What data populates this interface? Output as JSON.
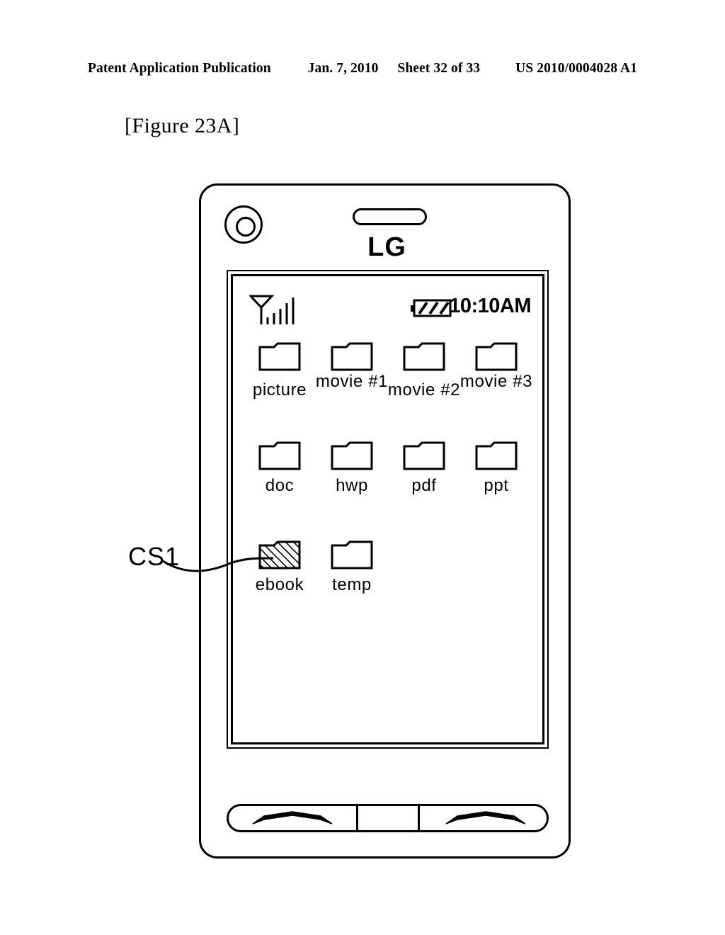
{
  "page_header": {
    "publication": "Patent Application Publication",
    "date": "Jan. 7, 2010",
    "sheet": "Sheet 32 of 33",
    "patent_number": "US 2010/0004028 A1"
  },
  "figure": {
    "label": "[Figure 23A]"
  },
  "device": {
    "brand": "LG",
    "camera_icon": "camera-lens-icon",
    "speaker_icon": "earpiece-speaker-icon",
    "status_bar": {
      "signal_icon": "antenna-signal-icon",
      "signal_bars": 5,
      "battery_icon": "battery-icon",
      "battery_segments": 3,
      "time": "10:10AM"
    },
    "folders": {
      "row_1": [
        {
          "label": "picture",
          "icon": "folder-icon",
          "selected": false
        },
        {
          "label": "movie #1",
          "icon": "folder-icon",
          "selected": false
        },
        {
          "label": "movie #2",
          "icon": "folder-icon",
          "selected": false
        },
        {
          "label": "movie #3",
          "icon": "folder-icon",
          "selected": false
        }
      ],
      "row_2": [
        {
          "label": "doc",
          "icon": "folder-icon",
          "selected": false
        },
        {
          "label": "hwp",
          "icon": "folder-icon",
          "selected": false
        },
        {
          "label": "pdf",
          "icon": "folder-icon",
          "selected": false
        },
        {
          "label": "ppt",
          "icon": "folder-icon",
          "selected": false
        }
      ],
      "row_3": [
        {
          "label": "ebook",
          "icon": "folder-icon-selected",
          "selected": true
        },
        {
          "label": "temp",
          "icon": "folder-icon",
          "selected": false
        }
      ]
    },
    "buttons": {
      "left_icon": "arc-key-icon",
      "middle_icon": "",
      "right_icon": "arc-key-icon"
    }
  },
  "annotations": {
    "cs1": "CS1"
  }
}
